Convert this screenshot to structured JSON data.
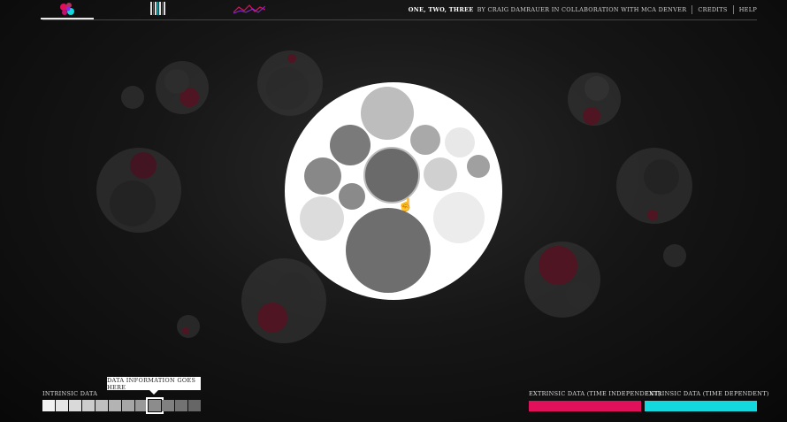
{
  "header": {
    "title": "One, Two, Three",
    "byline": "by Craig Damrauer in collaboration with MCA Denver",
    "links": [
      "Credits",
      "Help"
    ]
  },
  "nav": {
    "icons": [
      "bubbles-view-icon",
      "barcode-view-icon",
      "line-graph-view-icon"
    ]
  },
  "tooltip": {
    "text": "Data information goes here"
  },
  "bottom": {
    "intrinsic_label": "Intrinsic data",
    "extrinsic_independent_label": "Extrinsic data (time independent)",
    "extrinsic_dependent_label": "Extrinsic data (time dependent)",
    "swatch_colors": [
      "#f2f2f2",
      "#e6e6e6",
      "#d9d9d9",
      "#cccccc",
      "#bfbfbf",
      "#b3b3b3",
      "#a6a6a6",
      "#999999",
      "#8c8c8c",
      "#808080",
      "#737373",
      "#666666"
    ],
    "selected_swatch": 8,
    "extrinsic_independent_color": "#e0115a",
    "extrinsic_dependent_color": "#13d8dd"
  },
  "colors": {
    "accent_pink": "#e0115a",
    "accent_cyan": "#13d8dd"
  }
}
